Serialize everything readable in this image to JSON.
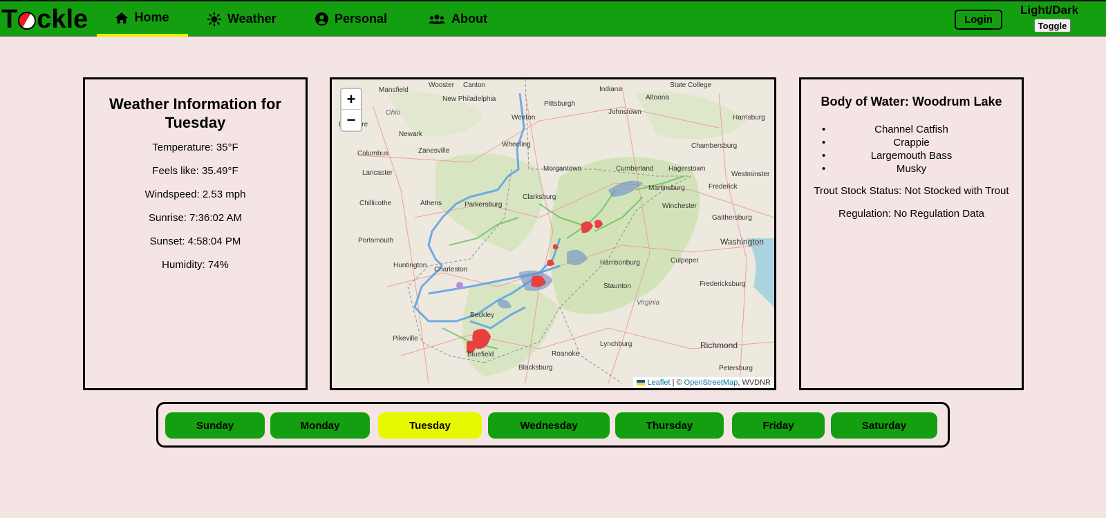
{
  "navbar": {
    "logo_pre": "T",
    "logo_post": "ckle",
    "items": [
      {
        "label": "Home",
        "icon": "home-icon"
      },
      {
        "label": "Weather",
        "icon": "sun-icon"
      },
      {
        "label": "Personal",
        "icon": "user-circle-icon"
      },
      {
        "label": "About",
        "icon": "users-icon"
      }
    ],
    "login_label": "Login",
    "theme_label": "Light/Dark",
    "toggle_label": "Toggle"
  },
  "weather": {
    "title": "Weather Information for Tuesday",
    "temperature": "Temperature: 35°F",
    "feels_like": "Feels like: 35.49°F",
    "windspeed": "Windspeed: 2.53 mph",
    "sunrise": "Sunrise: 7:36:02 AM",
    "sunset": "Sunset: 4:58:04 PM",
    "humidity": "Humidity: 74%"
  },
  "map": {
    "zoom_in": "+",
    "zoom_out": "−",
    "attribution_leaflet": "Leaflet",
    "attribution_sep": " | © ",
    "attribution_osm": "OpenStreetMap",
    "attribution_tail": ", WVDNR",
    "labels": [
      "Mansfield",
      "Wooster",
      "Canton",
      "Indiana",
      "Altoona",
      "State College",
      "Ohio",
      "New Philadelphia",
      "Pittsburgh",
      "Johnstown",
      "Harrisburg",
      "Delaware",
      "Newark",
      "Weirton",
      "Columbus",
      "Zanesville",
      "Wheeling",
      "Chambersburg",
      "Lancaster",
      "Morgantown",
      "Cumberland",
      "Hagerstown",
      "Westminster",
      "Chillicothe",
      "Athens",
      "Parkersburg",
      "Clarksburg",
      "Martinsburg",
      "Frederick",
      "Winchester",
      "Gaithersburg",
      "Washington",
      "Portsmouth",
      "Harrisonburg",
      "Culpeper",
      "Huntington",
      "Charleston",
      "Staunton",
      "Fredericksburg",
      "Virginia",
      "Beckley",
      "Pikeville",
      "Lynchburg",
      "Richmond",
      "Roanoke",
      "Bluefield",
      "Blacksburg",
      "Petersburg"
    ]
  },
  "water": {
    "title": "Body of Water: Woodrum Lake",
    "fish": [
      "Channel Catfish",
      "Crappie",
      "Largemouth Bass",
      "Musky"
    ],
    "trout_status": "Trout Stock Status: Not Stocked with Trout",
    "regulation": "Regulation: No Regulation Data"
  },
  "days": {
    "active": "Tuesday",
    "list": [
      "Sunday",
      "Monday",
      "Tuesday",
      "Wednesday",
      "Thursday",
      "Friday",
      "Saturday"
    ]
  },
  "colors": {
    "nav_green": "#149f10",
    "active_yellow": "#e6f900",
    "page_bg": "#f5e4e4"
  }
}
